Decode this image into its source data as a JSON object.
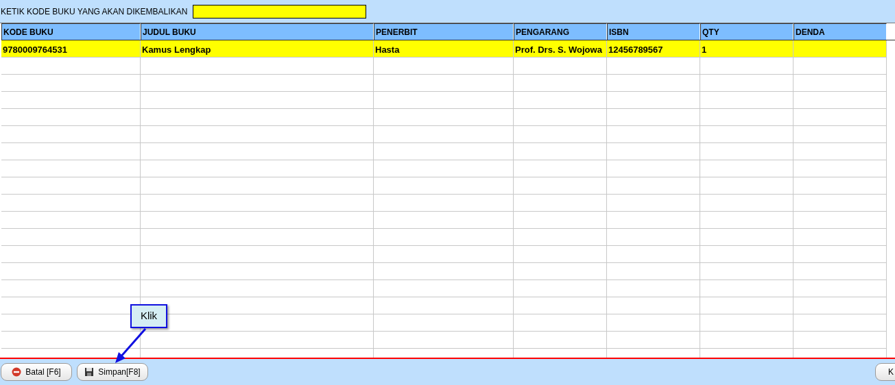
{
  "search": {
    "label": "KETIK KODE BUKU YANG AKAN DIKEMBALIKAN"
  },
  "table": {
    "columns": [
      "KODE BUKU",
      "JUDUL BUKU",
      "PENERBIT",
      "PENGARANG",
      "ISBN",
      "QTY",
      "DENDA"
    ],
    "rows": [
      {
        "selected": true,
        "cells": [
          "9780009764531",
          "Kamus Lengkap",
          "Hasta",
          "Prof. Drs. S. Wojowa",
          "12456789567",
          "1",
          ""
        ]
      }
    ]
  },
  "callout": {
    "text": "Klik"
  },
  "buttons": [
    {
      "kind": "cancel",
      "label": "Batal [F6]"
    },
    {
      "kind": "save",
      "label": "Simpan[F8]"
    },
    {
      "kind": "other",
      "label": "K"
    }
  ]
}
